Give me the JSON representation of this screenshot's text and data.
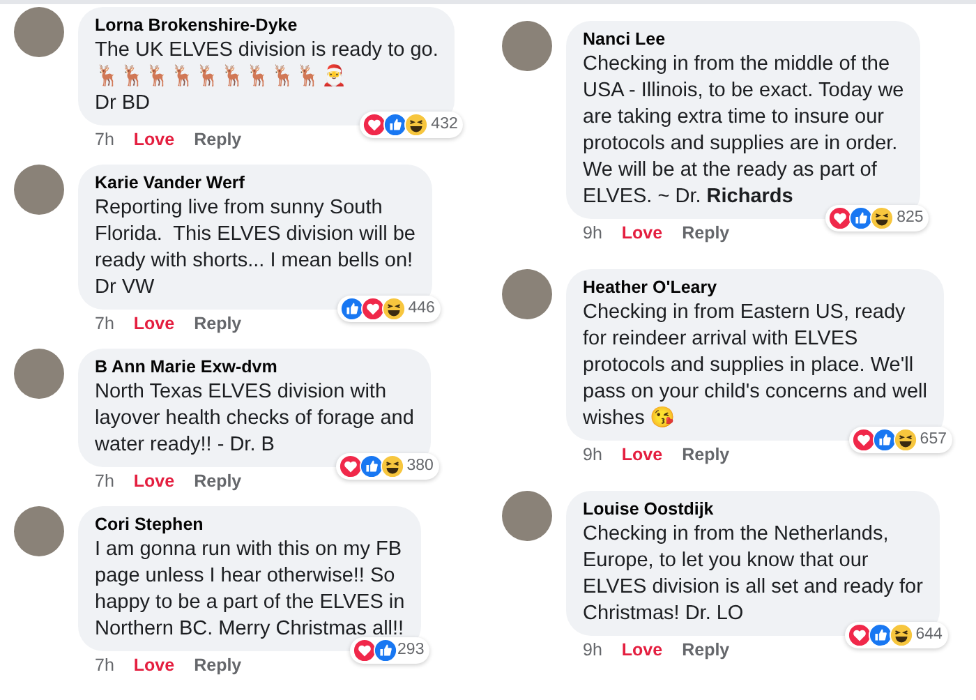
{
  "columns": [
    {
      "comments": [
        {
          "author": "Lorna Brokenshire-Dyke",
          "body": [
            "The UK ELVES division is ready to go.",
            "🦌🦌🦌🦌🦌🦌🦌🦌🦌🎅",
            "Dr BD"
          ],
          "time": "7h",
          "love": {
            "label": "Love",
            "active": true
          },
          "reply": "Reply",
          "reactions": [
            {
              "kind": "love"
            },
            {
              "kind": "like"
            },
            {
              "kind": "haha"
            }
          ],
          "count": "432"
        },
        {
          "author": "Karie Vander Werf",
          "body": [
            "Reporting live from sunny South\nFlorida.  This ELVES division will be\nready with shorts... I mean bells on!\nDr VW"
          ],
          "time": "7h",
          "love": {
            "label": "Love",
            "active": true
          },
          "reply": "Reply",
          "reactions": [
            {
              "kind": "like"
            },
            {
              "kind": "love"
            },
            {
              "kind": "haha"
            }
          ],
          "count": "446"
        },
        {
          "author": "B Ann Marie Exw-dvm",
          "body": [
            "North Texas ELVES division with\nlayover health checks of forage and\nwater ready!! - Dr. B"
          ],
          "time": "7h",
          "love": {
            "label": "Love",
            "active": true
          },
          "reply": "Reply",
          "reactions": [
            {
              "kind": "love"
            },
            {
              "kind": "like"
            },
            {
              "kind": "haha"
            }
          ],
          "count": "380"
        },
        {
          "author": "Cori Stephen",
          "body": [
            "I am gonna run with this on my FB\npage unless I hear otherwise!! So\nhappy to be a part of the ELVES in\nNorthern BC. Merry Christmas all!!"
          ],
          "time": "7h",
          "love": {
            "label": "Love",
            "active": true
          },
          "reply": "Reply",
          "reactions": [
            {
              "kind": "love"
            },
            {
              "kind": "like"
            }
          ],
          "count": "293"
        }
      ]
    },
    {
      "comments": [
        {
          "author": "Nanci Lee",
          "body": [
            "Checking in from the middle of the\nUSA - Illinois, to be exact. Today we\nare taking extra time to insure our\nprotocols and supplies are in order.\nWe will be at the ready as part of\nELVES. ~ Dr. **Richards**"
          ],
          "time": "9h",
          "love": {
            "label": "Love",
            "active": true
          },
          "reply": "Reply",
          "reactions": [
            {
              "kind": "love"
            },
            {
              "kind": "like"
            },
            {
              "kind": "haha"
            }
          ],
          "count": "825"
        },
        {
          "author": "Heather O'Leary",
          "body": [
            "Checking in from Eastern US, ready\nfor reindeer arrival with ELVES\nprotocols and supplies in place. We'll\npass on your child's concerns and well\nwishes 😘"
          ],
          "time": "9h",
          "love": {
            "label": "Love",
            "active": true
          },
          "reply": "Reply",
          "reactions": [
            {
              "kind": "love"
            },
            {
              "kind": "like"
            },
            {
              "kind": "haha"
            }
          ],
          "count": "657"
        },
        {
          "author": "Louise Oostdijk",
          "body": [
            "Checking in from the Netherlands,\nEurope, to let you know that our\nELVES division is all set and ready for\nChristmas! Dr. LO"
          ],
          "time": "9h",
          "love": {
            "label": "Love",
            "active": true
          },
          "reply": "Reply",
          "reactions": [
            {
              "kind": "love"
            },
            {
              "kind": "like"
            },
            {
              "kind": "haha"
            }
          ],
          "count": "644"
        }
      ]
    }
  ]
}
